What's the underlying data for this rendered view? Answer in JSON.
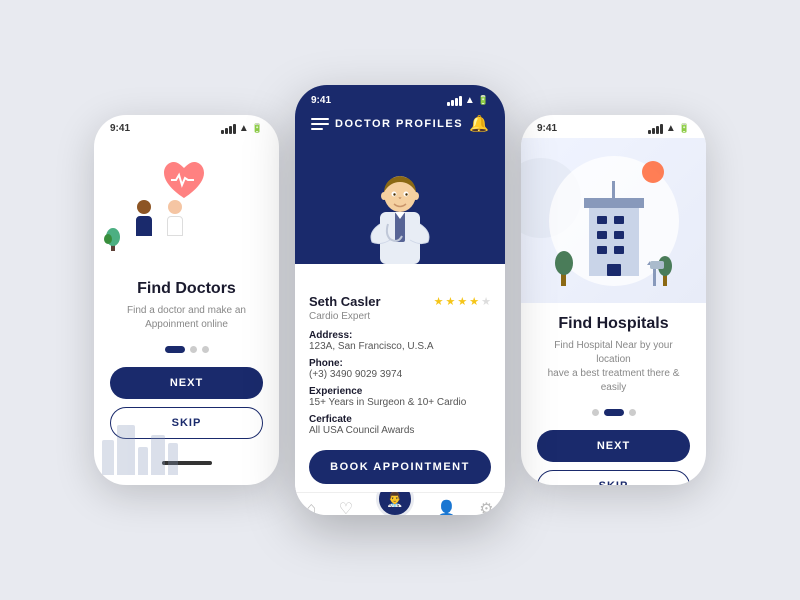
{
  "page": {
    "background": "#e8eaf0"
  },
  "left_phone": {
    "status_time": "9:41",
    "illustration_alt": "Doctors with heart rate illustration",
    "title": "Find Doctors",
    "subtitle": "Find a doctor and make an\nAppoinment online",
    "dots": [
      {
        "active": true
      },
      {
        "active": false
      },
      {
        "active": false
      }
    ],
    "btn_next": "NEXT",
    "btn_skip": "SKIP"
  },
  "center_phone": {
    "status_time": "9:41",
    "header_title": "DOCTOR PROFILES",
    "doctor_name": "Seth Casler",
    "doctor_specialty": "Cardio Expert",
    "stars_count": 4,
    "address_label": "Address:",
    "address_value": "123A, San Francisco, U.S.A",
    "phone_label": "Phone:",
    "phone_value": "(+3) 3490 9029 3974",
    "experience_label": "Experience",
    "experience_value": "15+ Years in Surgeon & 10+ Cardio",
    "certificate_label": "Cerficate",
    "certificate_value": "All USA Council Awards",
    "btn_book": "BOOK APPOINTMENT",
    "nav_items": [
      "home",
      "heart",
      "doctor",
      "user",
      "settings"
    ]
  },
  "right_phone": {
    "status_time": "9:41",
    "illustration_alt": "Hospital building illustration",
    "title": "Find Hospitals",
    "subtitle": "Find Hospital Near by your location\nhave a best treatment there & easily",
    "dots": [
      {
        "active": false
      },
      {
        "active": true
      },
      {
        "active": false
      }
    ],
    "btn_next": "NEXT",
    "btn_skip": "SKIP"
  }
}
